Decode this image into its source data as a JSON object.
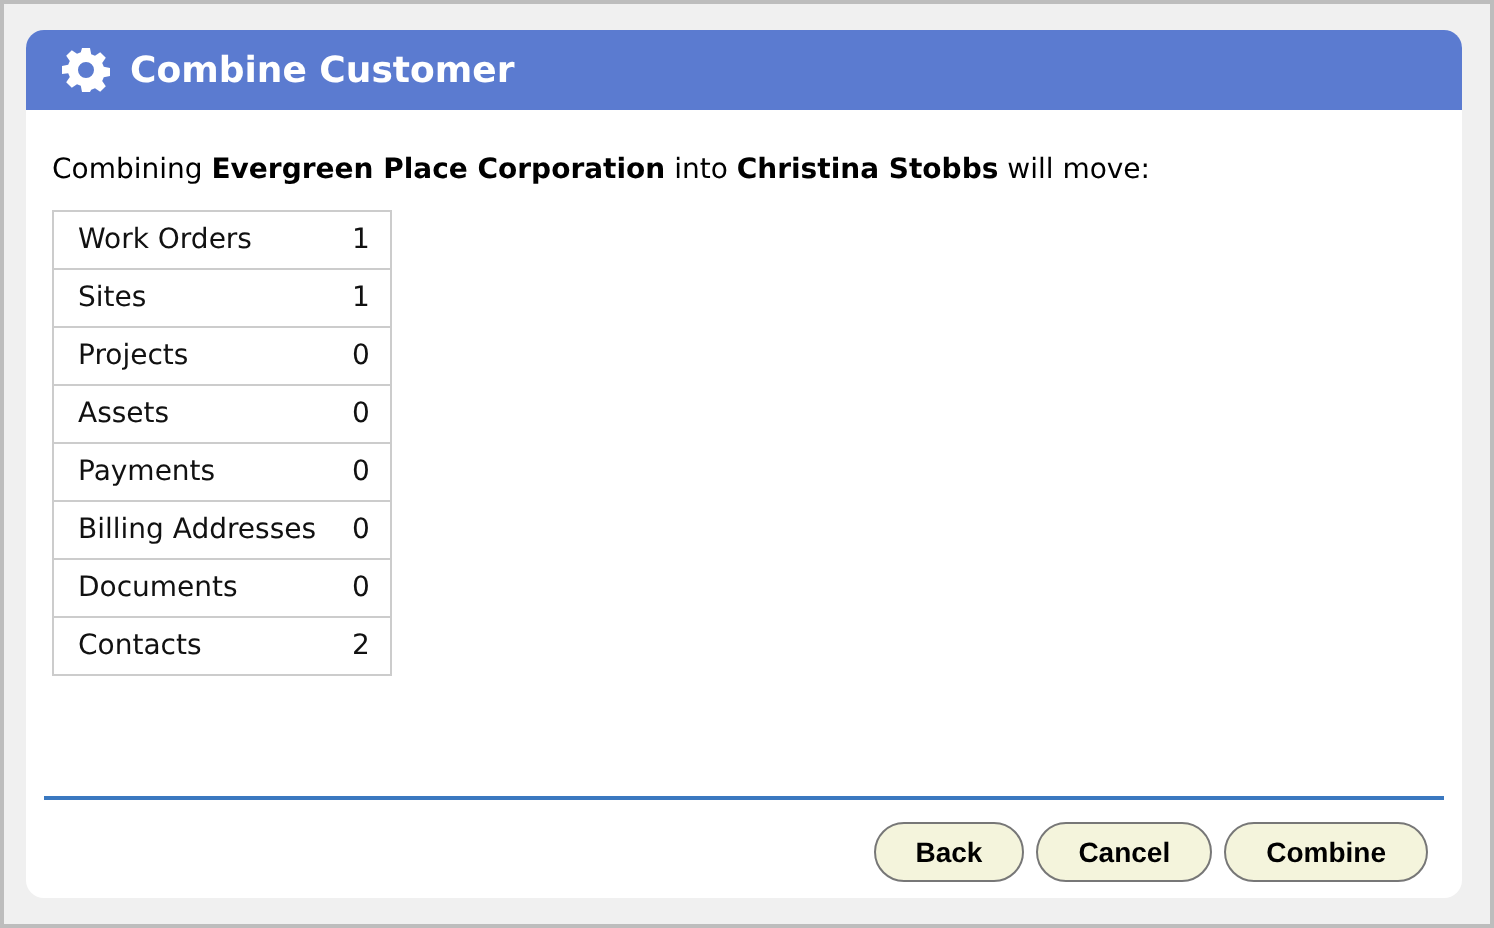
{
  "dialog": {
    "title": "Combine Customer"
  },
  "message": "Combining **Evergreen Place Corporation** into **Christina Stobbs** will move:",
  "counts": [
    {
      "label": "Work Orders",
      "value": "1"
    },
    {
      "label": "Sites",
      "value": "1"
    },
    {
      "label": "Projects",
      "value": "0"
    },
    {
      "label": "Assets",
      "value": "0"
    },
    {
      "label": "Payments",
      "value": "0"
    },
    {
      "label": "Billing Addresses",
      "value": "0"
    },
    {
      "label": "Documents",
      "value": "0"
    },
    {
      "label": "Contacts",
      "value": "2"
    }
  ],
  "buttons": [
    "Back",
    "Cancel",
    "Combine"
  ]
}
